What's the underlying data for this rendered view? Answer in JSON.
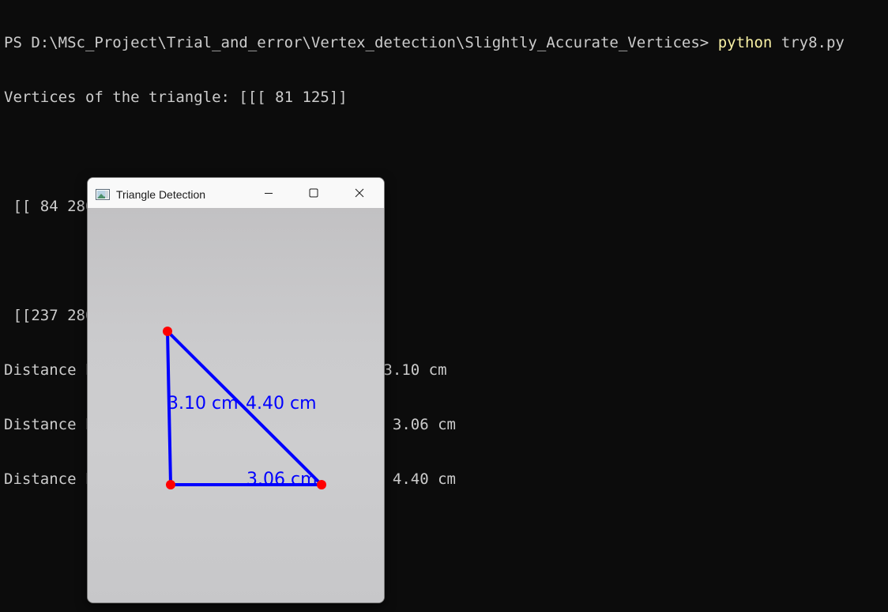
{
  "terminal": {
    "prompt": "PS D:\\MSc_Project\\Trial_and_error\\Vertex_detection\\Slightly_Accurate_Vertices> ",
    "command_keyword": "python",
    "command_args": " try8.py",
    "output_lines": [
      "Vertices of the triangle: [[[ 81 125]]",
      "",
      " [[ 84 280]]",
      "",
      " [[237 280]]]",
      "Distance between (81, 125) and (84, 280): 3.10 cm",
      "Distance between (84, 280) and (237, 280): 3.06 cm",
      "Distance between (237, 280) and (81, 125): 4.40 cm"
    ]
  },
  "window": {
    "title": "Triangle Detection",
    "icons": {
      "app": "image-window-icon",
      "minimize": "minimize-icon",
      "maximize": "maximize-icon",
      "close": "close-icon"
    }
  },
  "detection": {
    "line_color": "#0000ff",
    "vertex_color": "#ff0000",
    "labels": {
      "side_a": "3.10 cm",
      "side_c": "4.40 cm",
      "side_b": "3.06 cm"
    }
  },
  "colors": {
    "terminal_bg": "#0c0c0c",
    "terminal_text": "#cccccc",
    "command_highlight": "#f9f1a5"
  }
}
